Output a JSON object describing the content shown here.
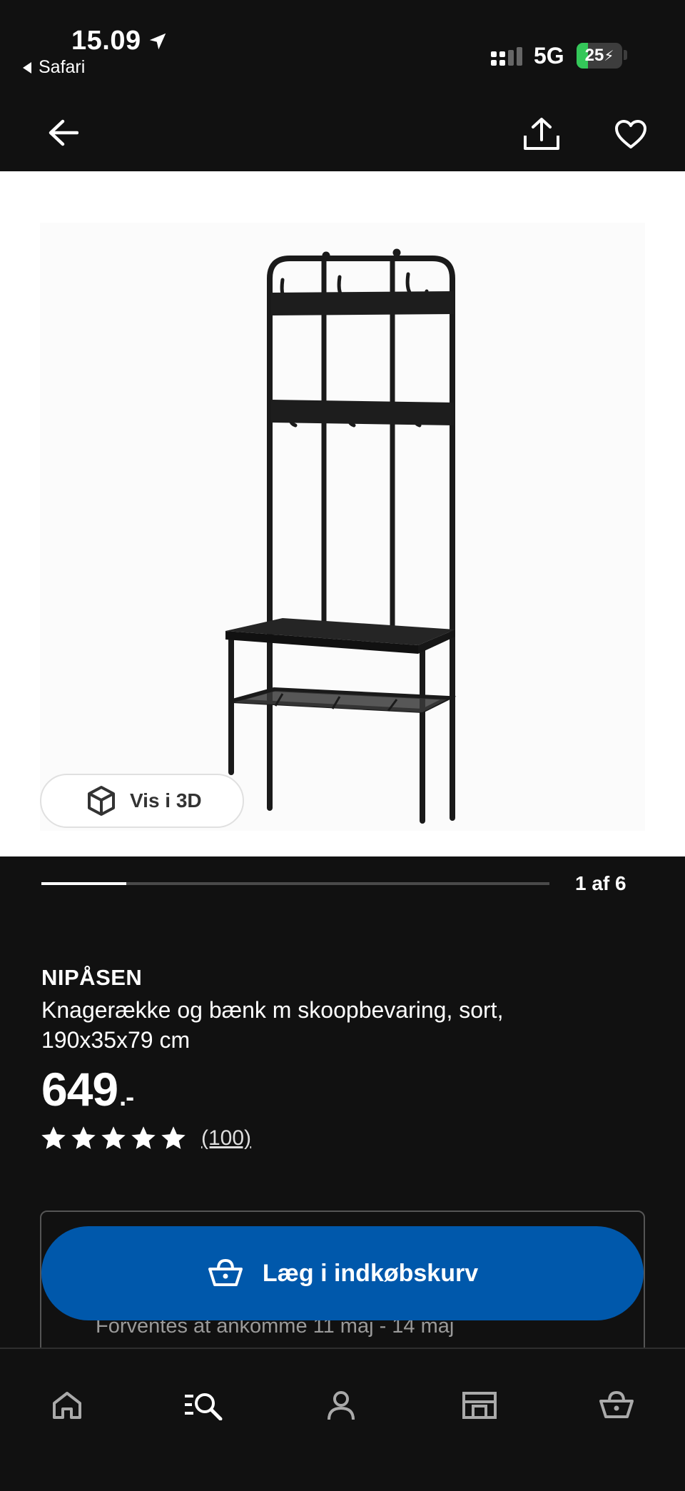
{
  "status_bar": {
    "time": "15.09",
    "back_app": "Safari",
    "network": "5G",
    "battery_level": "25"
  },
  "header": {
    "back_icon": "arrow-left-icon",
    "share_icon": "share-icon",
    "favorite_icon": "heart-icon"
  },
  "gallery": {
    "view_3d_label": "Vis i 3D",
    "current_index": 1,
    "total": 6,
    "counter_text": "1 af 6",
    "progress_fraction": 0.167
  },
  "product": {
    "name": "NIPÅSEN",
    "description": "Knagerække og bænk m skoopbevaring, sort, 190x35x79 cm",
    "price": "649",
    "price_suffix": ".-",
    "rating_stars": 5,
    "review_count": "(100)"
  },
  "purchase": {
    "add_to_cart_label": "Læg i indkøbskurv",
    "delivery_estimate": "Forventes at ankomme 11 maj - 14 maj"
  },
  "tab_bar": {
    "items": [
      {
        "icon": "home-icon"
      },
      {
        "icon": "search-list-icon"
      },
      {
        "icon": "profile-icon"
      },
      {
        "icon": "store-icon"
      },
      {
        "icon": "basket-icon"
      }
    ]
  },
  "colors": {
    "background": "#111111",
    "primary_button": "#0058ab",
    "battery_green": "#34c759"
  }
}
